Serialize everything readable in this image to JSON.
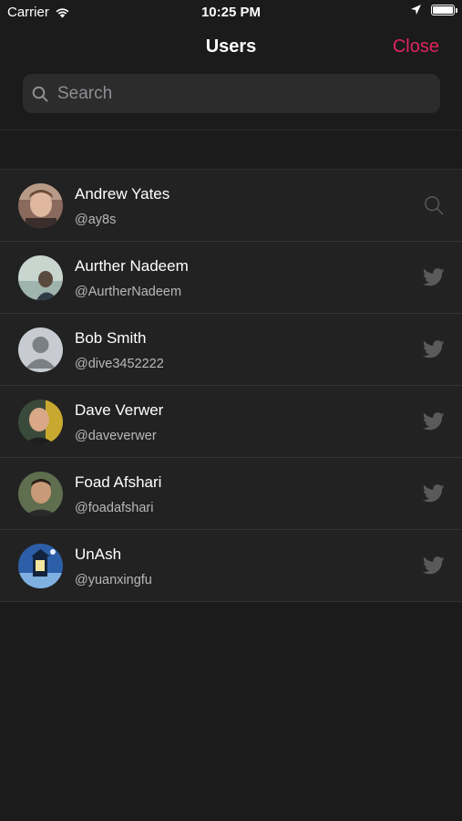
{
  "status_bar": {
    "carrier": "Carrier",
    "time": "10:25 PM"
  },
  "nav": {
    "title": "Users",
    "close_label": "Close"
  },
  "search": {
    "placeholder": "Search",
    "value": ""
  },
  "users": [
    {
      "name": "Andrew Yates",
      "handle": "@ay8s",
      "action_icon": "search-icon"
    },
    {
      "name": "Aurther Nadeem",
      "handle": "@AurtherNadeem",
      "action_icon": "twitter-icon"
    },
    {
      "name": "Bob Smith",
      "handle": "@dive3452222",
      "action_icon": "twitter-icon"
    },
    {
      "name": "Dave Verwer",
      "handle": "@daveverwer",
      "action_icon": "twitter-icon"
    },
    {
      "name": "Foad Afshari",
      "handle": "@foadafshari",
      "action_icon": "twitter-icon"
    },
    {
      "name": "UnAsh",
      "handle": "@yuanxingfu",
      "action_icon": "twitter-icon"
    }
  ],
  "colors": {
    "accent": "#e0245e",
    "background": "#1b1b1b",
    "row": "#222222",
    "icon": "#5a5a5a"
  }
}
